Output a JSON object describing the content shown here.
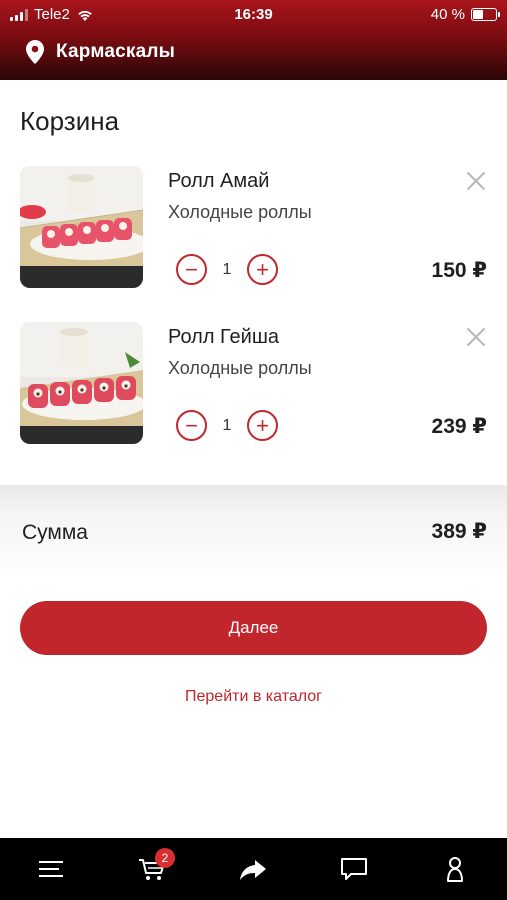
{
  "status_bar": {
    "carrier": "Tele2",
    "time": "16:39",
    "battery": "40 %",
    "battery_level": 0.4
  },
  "header": {
    "icon": "location-pin-icon",
    "city": "Кармаскалы"
  },
  "cart": {
    "title": "Корзина",
    "items": [
      {
        "name": "Ролл Амай",
        "category": "Холодные роллы",
        "quantity": "1",
        "price": "150 ₽"
      },
      {
        "name": "Ролл Гейша",
        "category": "Холодные роллы",
        "quantity": "1",
        "price": "239 ₽"
      }
    ]
  },
  "summary": {
    "label": "Сумма",
    "total": "389 ₽"
  },
  "actions": {
    "next_label": "Далее",
    "catalog_label": "Перейти в каталог"
  },
  "bottom_nav": {
    "items": [
      "menu-icon",
      "cart-icon",
      "share-icon",
      "chat-icon",
      "profile-icon"
    ],
    "cart_badge": "2"
  },
  "colors": {
    "accent": "#c0262b",
    "header_top": "#a8151b",
    "header_bottom": "#2a0606"
  }
}
